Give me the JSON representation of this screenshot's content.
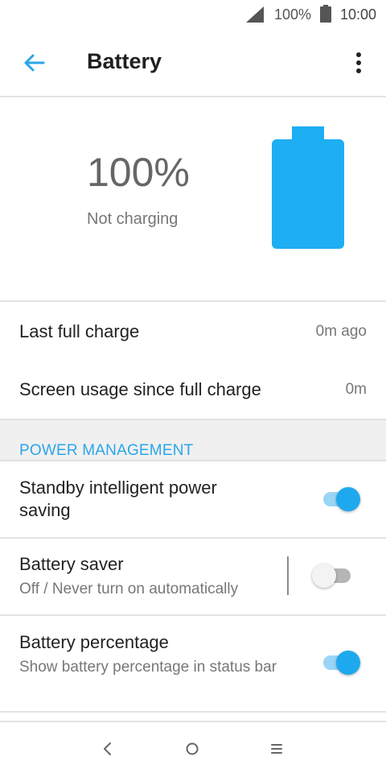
{
  "status_bar": {
    "battery_percent": "100%",
    "time": "10:00",
    "icons": [
      "signal-icon",
      "battery-icon"
    ]
  },
  "app_bar": {
    "title": "Battery",
    "icons": [
      "back-arrow-icon",
      "more-vert-icon"
    ],
    "accent_color": "#2aa6ea"
  },
  "hero": {
    "percent": "100%",
    "charge_state": "Not charging",
    "battery_level": 1.0,
    "battery_color": "#1eaef3"
  },
  "info_rows": [
    {
      "label": "Last full charge",
      "value": "0m ago"
    },
    {
      "label": "Screen usage since full charge",
      "value": "0m"
    }
  ],
  "section": {
    "title": "POWER MANAGEMENT"
  },
  "preferences": [
    {
      "title": "Standby intelligent power saving",
      "summary": "",
      "enabled": true
    },
    {
      "title": "Battery saver",
      "summary": "Off / Never turn on automatically",
      "enabled": false
    },
    {
      "title": "Battery percentage",
      "summary": "Show battery percentage in status bar",
      "enabled": true
    }
  ],
  "nav_bar": {
    "icons": [
      "nav-back-icon",
      "nav-home-icon",
      "nav-menu-icon"
    ]
  }
}
